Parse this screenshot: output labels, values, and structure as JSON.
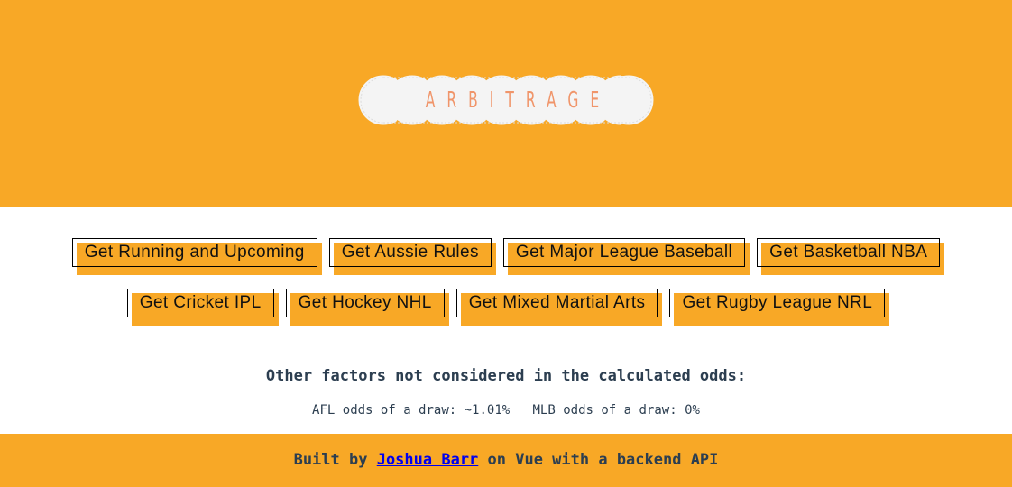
{
  "header": {
    "background": "#f8a826",
    "logo_text": "ARBITRAGE",
    "logo_text_color": "#f0956a"
  },
  "buttons": {
    "row1": [
      {
        "label": "Get Running and Upcoming"
      },
      {
        "label": "Get Aussie Rules"
      },
      {
        "label": "Get Major League Baseball"
      },
      {
        "label": "Get Basketball NBA"
      }
    ],
    "row2": [
      {
        "label": "Get Cricket IPL"
      },
      {
        "label": "Get Hockey NHL"
      },
      {
        "label": "Get Mixed Martial Arts"
      },
      {
        "label": "Get Rugby League NRL"
      }
    ]
  },
  "factors": {
    "title": "Other factors not considered in the calculated odds:",
    "afl": "AFL odds of a draw: ~1.01%",
    "mlb": "MLB odds of a draw: 0%"
  },
  "footer": {
    "prefix": "Built by ",
    "author_link": "Joshua Barr",
    "suffix": " on Vue with a backend API",
    "link_color": "#0000ee"
  }
}
